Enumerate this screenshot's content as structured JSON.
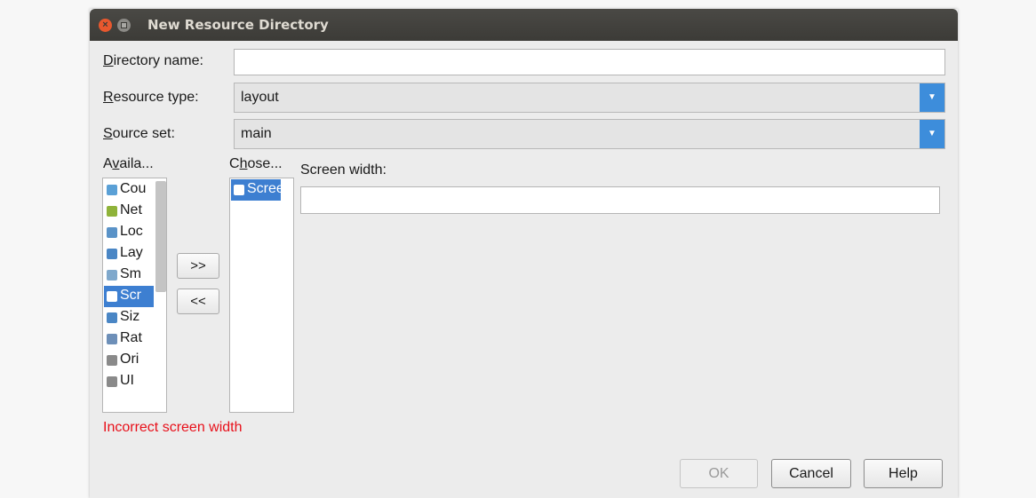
{
  "window": {
    "title": "New Resource Directory",
    "close_glyph": "×"
  },
  "form": {
    "directory_name": {
      "label_mnemonic": "D",
      "label_rest": "irectory name:",
      "value": ""
    },
    "resource_type": {
      "label_mnemonic": "R",
      "label_rest": "esource type:",
      "value": "layout"
    },
    "source_set": {
      "label_mnemonic": "S",
      "label_rest": "ource set:",
      "value": "main"
    }
  },
  "available": {
    "label_pre": "A",
    "label_mnemonic": "v",
    "label_rest": "aila...",
    "items": [
      {
        "text": "Cou",
        "icon": "country-icon",
        "color": "#5aa0d6"
      },
      {
        "text": "Net",
        "icon": "network-icon",
        "color": "#8fb33a"
      },
      {
        "text": "Loc",
        "icon": "locale-icon",
        "color": "#5a93c8"
      },
      {
        "text": "Lay",
        "icon": "layout-direction-icon",
        "color": "#4a86c5"
      },
      {
        "text": "Sm",
        "icon": "smallest-width-icon",
        "color": "#7fa8cc"
      },
      {
        "text": "Scr",
        "icon": "screen-height-icon",
        "color": "#ffffff",
        "selected": true
      },
      {
        "text": "Siz",
        "icon": "size-icon",
        "color": "#4a86c5"
      },
      {
        "text": "Rat",
        "icon": "ratio-icon",
        "color": "#6d8fb8"
      },
      {
        "text": "Ori",
        "icon": "orientation-icon",
        "color": "#8a8a8a"
      },
      {
        "text": "UI",
        "icon": "ui-mode-icon",
        "color": "#8a8a8a"
      }
    ]
  },
  "chosen": {
    "label_pre": "C",
    "label_mnemonic": "h",
    "label_rest": "ose...",
    "items": [
      {
        "text": "Scree",
        "icon": "screen-width-icon",
        "selected": true
      }
    ]
  },
  "move_buttons": {
    "add": ">>",
    "remove": "<<"
  },
  "detail": {
    "label": "Screen width:",
    "value": ""
  },
  "error_message": "Incorrect screen width",
  "buttons": {
    "ok": "OK",
    "cancel": "Cancel",
    "help": "Help"
  },
  "colors": {
    "accent": "#3d8ddb",
    "selection": "#3d7fd1",
    "error": "#e8101a",
    "titlebar": "#3c3b37"
  }
}
